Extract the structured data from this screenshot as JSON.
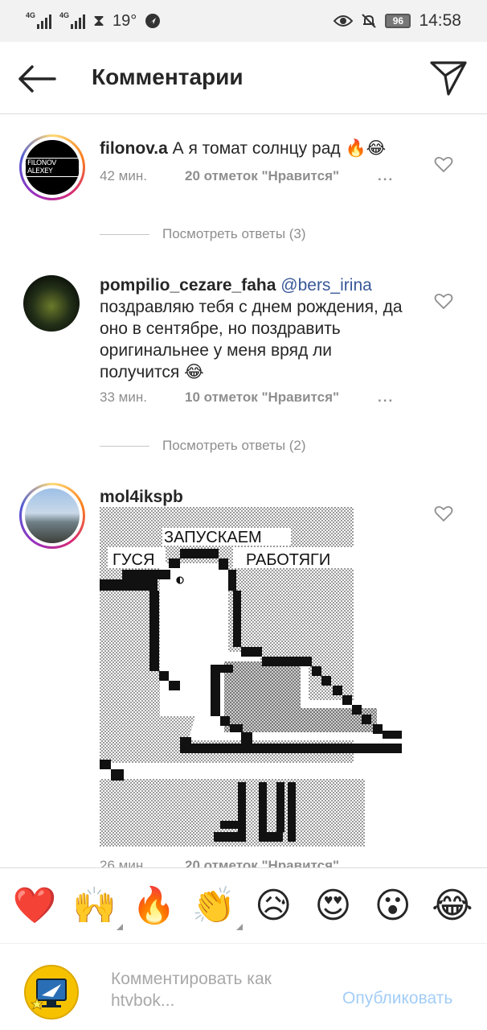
{
  "status_bar": {
    "net1": "4G",
    "net2": "4G",
    "temperature": "19°",
    "battery": "96",
    "time": "14:58"
  },
  "header": {
    "title": "Комментарии"
  },
  "comments": [
    {
      "username": "filonov.a",
      "text": "А я томат солнцу рад 🔥😂",
      "avatar_label": "FILONOV ALEXEY",
      "time": "42 мин.",
      "likes": "20 отметок \"Нравится\"",
      "more": "...",
      "view_replies": "Посмотреть ответы (3)"
    },
    {
      "username": "pompilio_cezare_faha",
      "mention": "@bers_irina",
      "text": "поздравляю тебя с днем рождения, да оно в сентябре, но поздравить оригинальнее у меня вряд ли получится 😂",
      "time": "33 мин.",
      "likes": "10 отметок \"Нравится\"",
      "more": "...",
      "view_replies": "Посмотреть ответы (2)"
    },
    {
      "username": "mol4ikspb",
      "meme": {
        "top_text": "ЗАПУСКАЕМ",
        "left_text": "ГУСЯ",
        "right_text": "РАБОТЯГИ"
      },
      "time": "26 мин.",
      "likes": "20 отметок \"Нравится\"",
      "more": "..."
    }
  ],
  "emoji_bar": [
    "❤️",
    "🙌",
    "🔥",
    "👏",
    "😥",
    "😍",
    "😮",
    "😂"
  ],
  "input": {
    "placeholder": "Комментировать как htvbok...",
    "post_label": "Опубликовать"
  },
  "colors": {
    "mention": "#385898",
    "post_disabled": "#a3cdf7",
    "muted": "#8e8e8e"
  }
}
